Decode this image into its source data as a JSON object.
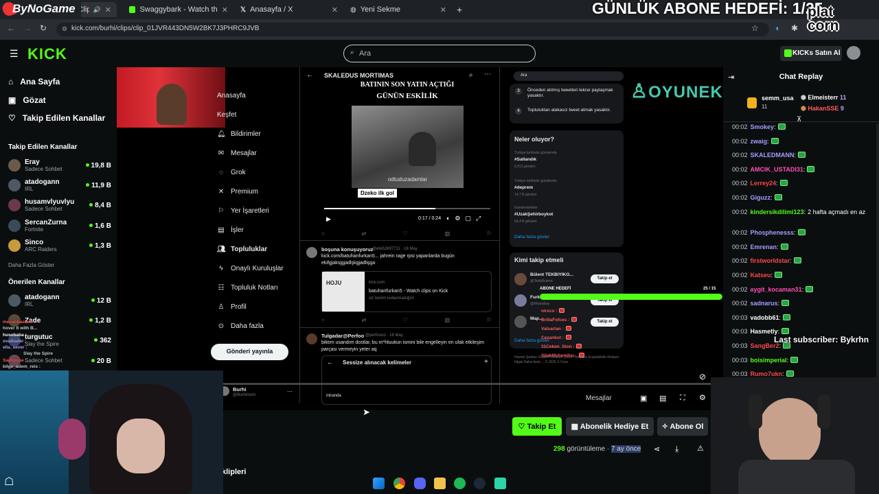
{
  "browser": {
    "tabs": [
      {
        "label": "Burhi - Clips on Kick",
        "active": true
      },
      {
        "label": "Swaggybark - Watch the VOD o",
        "active": false
      },
      {
        "label": "Anasayfa / X",
        "active": false
      },
      {
        "label": "Yeni Sekme",
        "active": false
      }
    ],
    "url": "kick.com/burhi/clips/clip_01JVR443DN5W2BK7J3PHRC9JVB"
  },
  "overlay": {
    "brand": "ByNoGame",
    "goal": "GÜNLÜK ABONE HEDEFİ: 1/25",
    "platcorn": "plat corn",
    "last_subscriber": "Last subscriber: Bykrhn"
  },
  "kick": {
    "logo": "KICK",
    "search_placeholder": "Ara",
    "buy_kicks": "KICKs Satın Al"
  },
  "sidebar": {
    "nav": [
      {
        "label": "Ana Sayfa",
        "icon": "home-icon"
      },
      {
        "label": "Gözat",
        "icon": "browse-icon"
      },
      {
        "label": "Takip Edilen Kanallar",
        "icon": "heart-icon"
      }
    ],
    "followed_header": "Takip Edilen Kanallar",
    "followed": [
      {
        "name": "Eray",
        "game": "Sadece Sohbet",
        "viewers": "19,8 B"
      },
      {
        "name": "atadogann",
        "game": "IRL",
        "viewers": "11,9 B"
      },
      {
        "name": "husamvlyuvlyu",
        "game": "Sadece Sohbet",
        "viewers": "8,4 B"
      },
      {
        "name": "SercanZurna",
        "game": "Fortnite",
        "viewers": "1,6 B"
      },
      {
        "name": "Sinco",
        "game": "ARC Raiders",
        "viewers": "1,3 B"
      }
    ],
    "show_more": "Daha Fazla Göster",
    "recommended_header": "Önerilen Kanallar",
    "recommended": [
      {
        "name": "atadogann",
        "game": "IRL",
        "viewers": "12 B"
      },
      {
        "name": "Zade",
        "game": "",
        "viewers": "1,2 B"
      },
      {
        "name": "turgutuc",
        "game": "Slay the Spire",
        "viewers": "362"
      },
      {
        "name": "",
        "game": "Sadece Sohbet",
        "viewers": "20 B"
      }
    ]
  },
  "x_ui": {
    "nav": [
      {
        "label": "Anasayfa",
        "icon": "home-icon"
      },
      {
        "label": "Keşfet",
        "icon": "search-icon"
      },
      {
        "label": "Bildirimler",
        "icon": "bell-icon"
      },
      {
        "label": "Mesajlar",
        "icon": "mail-icon"
      },
      {
        "label": "Grok",
        "icon": "grok-icon"
      },
      {
        "label": "Premium",
        "icon": "x-icon"
      },
      {
        "label": "Yer İşaretleri",
        "icon": "bookmark-icon"
      },
      {
        "label": "İşler",
        "icon": "briefcase-icon"
      },
      {
        "label": "Topluluklar",
        "icon": "people-icon"
      },
      {
        "label": "Onaylı Kuruluşlar",
        "icon": "bolt-icon"
      },
      {
        "label": "Topluluk Notları",
        "icon": "notes-icon"
      },
      {
        "label": "Profil",
        "icon": "person-icon"
      },
      {
        "label": "Daha fazla",
        "icon": "more-icon"
      }
    ],
    "post_button": "Gönderi yayınla",
    "profile_name": "Burhi",
    "profile_handle": "@Burhimum",
    "feed_title": "SKALEDUS MORTIMAS",
    "meme_top": "BATININ SON YATIN AÇTIĞI",
    "meme_sub": "GÜNÜN ESKİLİK",
    "meme_caption": "odtuduzadamlar",
    "meme_label": "Dzeko ilk gol",
    "video_time": "0:17 / 0:24",
    "tweet1": {
      "user": "boşuna konuşuyoruz",
      "handle": "@efe52697711 · 16 May",
      "text": "kick.com/batuhanfurkan5... jahrein rage rpsi yapanlarda bugün ekifgjaksjgjadlşkgjadlişga",
      "card_domain": "kick.com",
      "card_title": "batuhanfurkan5 - Watch clips on Kick",
      "card_desc": "siz benim kullanmadığım",
      "card_image_text": "HOJU"
    },
    "tweet2": {
      "user": "Tulgadar@Perfoo",
      "handle": "@perfoooo · 16 May",
      "text": "biktım usandım dostlar, bu m*hluukun ismini bile engelleyin en ufak etkileşim parçası vermeyin yeter aq",
      "modal_title": "Sessize alınacak kelimeler",
      "modal_input": "miranda"
    },
    "right_search": "Ara",
    "rules": [
      {
        "n": "3",
        "text": "Önceden atılmış tweetleri tekrar paylaşmak yasaktır."
      },
      {
        "n": "4",
        "text": "Topluluktan alakasız tweet atmak yasaktır."
      }
    ],
    "trends_title": "Neler oluyor?",
    "trends": [
      {
        "meta": "Türkiye tarihinde gündemde",
        "tag": "#Sallandık",
        "count": "6.013 gönderi"
      },
      {
        "meta": "Türkiye tarihinde gündemde",
        "tag": "#deprem",
        "count": "14,7 B gönderi"
      },
      {
        "meta": "Gündemdekiler",
        "tag": "#UzakŞehirboykot",
        "count": "64,4 B gönderi"
      }
    ],
    "trends_more": "Daha fazla göster",
    "who_title": "Kimi takip etmeli",
    "who": [
      {
        "name": "Bülent TEKBIYIKO...",
        "handle": "@TekbBulent",
        "button": "Takip et"
      },
      {
        "name": "Furk...",
        "handle": "@frkarabay",
        "button": "Takip et"
      },
      {
        "name": "Map...",
        "handle": "",
        "button": "Takip et"
      }
    ],
    "who_more": "Daha fazla göster",
    "footer": "Hizmet Şartları  Gizlilik Politikası  Çerez Politikası  Erişilebilirlik  Reklam bilgisi  Daha fazla ...  © 2025 X Corp.",
    "messages": "Mesajlar"
  },
  "sub_goal": {
    "label": "ABONE HEDEFİ",
    "count": "25 / 15",
    "progress": 1.0,
    "subs": [
      "nirxco :",
      "BrillaFofces :",
      "Valsartan :",
      "Cezankut :",
      "31Ceken_Sion :",
      "SilahMuhendisi :"
    ]
  },
  "webcam_events": [
    "mevanbasteril :",
    "hover It with B...",
    "husobaba :",
    "ovalbadei :",
    "ella_sever :",
    "Slay the Spire",
    "Saatipuse :",
    "bilge_adem_reis :"
  ],
  "under_video": {
    "follow": "Takip Et",
    "gift": "Abonelik Hediye Et",
    "subscribe": "Abone Ol",
    "views_count": "298",
    "views_label": "görüntüleme",
    "ago": "7 ay önce",
    "partial_heading": "klipleri"
  },
  "chat": {
    "title": "Chat Replay",
    "top_gifters": [
      {
        "name": "semm_usa",
        "count": "11"
      },
      {
        "name": "Elmeisterr",
        "count": "11"
      },
      {
        "name": "HakanSSE",
        "count": "9"
      }
    ],
    "messages": [
      {
        "time": "00:02",
        "user": "Smokey",
        "color": "#a89cff",
        "text": ""
      },
      {
        "time": "00:02",
        "user": "zwaig",
        "color": "#a89cff",
        "text": ""
      },
      {
        "time": "00:02",
        "user": "SKALEDMANN",
        "color": "#a89cff",
        "text": ""
      },
      {
        "time": "00:02",
        "user": "AMCIK_USTADI31",
        "color": "#ff4fb0",
        "text": ""
      },
      {
        "time": "00:02",
        "user": "Lerrey24",
        "color": "#ff4646",
        "text": ""
      },
      {
        "time": "00:02",
        "user": "Giguzz",
        "color": "#a89cff",
        "text": ""
      },
      {
        "time": "00:02",
        "user": "kindersikdilimi123",
        "color": "#53fc18",
        "text": "2 hafta açmadı en az"
      },
      {
        "time": "00:02",
        "user": "Phosphenesss",
        "color": "#a89cff",
        "text": ""
      },
      {
        "time": "00:02",
        "user": "Emrenan",
        "color": "#a89cff",
        "text": ""
      },
      {
        "time": "00:02",
        "user": "firstworldstar",
        "color": "#ff4646",
        "text": ""
      },
      {
        "time": "00:02",
        "user": "Katseu",
        "color": "#ff4646",
        "text": ""
      },
      {
        "time": "00:02",
        "user": "aygit_kocaman31",
        "color": "#ff4fb0",
        "text": ""
      },
      {
        "time": "00:02",
        "user": "sadnarus",
        "color": "#a89cff",
        "text": ""
      },
      {
        "time": "00:03",
        "user": "vadobb61",
        "color": "#ffffff",
        "text": ""
      },
      {
        "time": "00:03",
        "user": "Hasmetly",
        "color": "#ffffff",
        "text": ""
      },
      {
        "time": "00:03",
        "user": "SangBer2",
        "color": "#ff4646",
        "text": ""
      },
      {
        "time": "00:03",
        "user": "boisimperial",
        "color": "#53fc18",
        "text": ""
      },
      {
        "time": "00:03",
        "user": "Rumo7ukn",
        "color": "#ff4646",
        "text": ""
      }
    ]
  },
  "colors": {
    "kick_green": "#53fc18",
    "page_bg": "#0b0e0f",
    "button_bg": "#2a2f33",
    "x_card": "#16181c"
  }
}
